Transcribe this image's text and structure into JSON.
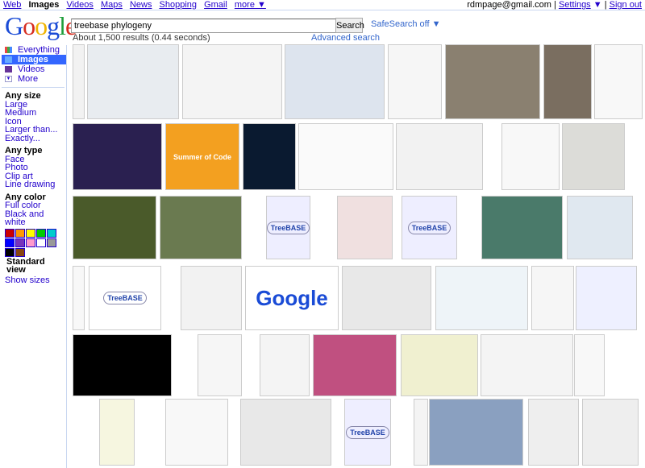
{
  "topbar": {
    "links": [
      "Web",
      "Images",
      "Videos",
      "Maps",
      "News",
      "Shopping",
      "Gmail",
      "more ▼"
    ],
    "user": "rdmpage@gmail.com",
    "settings": "Settings",
    "settings_arrow": "▼",
    "signout": "Sign out",
    "sep": "|"
  },
  "logo": "Google",
  "search": {
    "value": "treebase phylogeny",
    "button": "Search",
    "safesearch": "SafeSearch off ▼",
    "stats": "About 1,500 results (0.44 seconds)",
    "advanced": "Advanced search"
  },
  "sidebar": {
    "nav": [
      "Everything",
      "Images",
      "Videos",
      "More"
    ],
    "size": {
      "heading": "Any size",
      "items": [
        "Large",
        "Medium",
        "Icon",
        "Larger than...",
        "Exactly..."
      ]
    },
    "type": {
      "heading": "Any type",
      "items": [
        "Face",
        "Photo",
        "Clip art",
        "Line drawing"
      ]
    },
    "color": {
      "heading": "Any color",
      "items": [
        "Full color",
        "Black and white"
      ],
      "swatches": [
        "#cc0000",
        "#ff9900",
        "#ffff00",
        "#00cc00",
        "#00cccc",
        "#0000ff",
        "#7733bb",
        "#ff99cc",
        "#ffffff",
        "#999999",
        "#000000",
        "#884411"
      ]
    },
    "standard_view": "Standard view",
    "show_sizes": "Show sizes"
  },
  "tiles": [
    {
      "bg": "#f2f2f2"
    },
    {
      "bg": "#e8ecf0"
    },
    {
      "bg": "#f4f4f4"
    },
    {
      "bg": "#dde4ee"
    },
    {
      "bg": "#f6f6f6"
    },
    {
      "bg": "#8a8070"
    },
    {
      "bg": "#7a6e60"
    },
    {
      "bg": "#f8f8f8"
    },
    {
      "bg": "#2a2050"
    },
    {
      "bg": "#f3a020",
      "label": "Summer of Code"
    },
    {
      "bg": "#0a1a30"
    },
    {
      "bg": "#fafafa"
    },
    {
      "bg": "#f2f2f2"
    },
    {
      "bg": "#f8f8f8"
    },
    {
      "bg": "#dcdcd8"
    },
    {
      "bg": "#4a5a2a"
    },
    {
      "bg": "#6a7a50"
    },
    {
      "bg": "#eef",
      "label": "TreeBASE"
    },
    {
      "bg": "#f0e0e0"
    },
    {
      "bg": "#eef",
      "label": "TreeBASE"
    },
    {
      "bg": "#4a7a6a"
    },
    {
      "bg": "#e0e8f0"
    },
    {
      "bg": "#f8f8f8"
    },
    {
      "bg": "#fff",
      "label": "TreeBASE"
    },
    {
      "bg": "#f2f2f2"
    },
    {
      "bg": "#fff",
      "label": "Google"
    },
    {
      "bg": "#e8e8e8"
    },
    {
      "bg": "#eef4f8"
    },
    {
      "bg": "#f6f6f6"
    },
    {
      "bg": "#eef0ff"
    },
    {
      "bg": "#000"
    },
    {
      "bg": "#f6f6f6"
    },
    {
      "bg": "#f4f4f4"
    },
    {
      "bg": "#c05080"
    },
    {
      "bg": "#f0f0d0"
    },
    {
      "bg": "#f4f4f4"
    },
    {
      "bg": "#f8f8f8"
    },
    {
      "bg": "#f6f6e0"
    },
    {
      "bg": "#f8f8f8"
    },
    {
      "bg": "#e8e8e8"
    },
    {
      "bg": "#eef",
      "label": "TreeBASE"
    },
    {
      "bg": "#f4f4f4"
    },
    {
      "bg": "#8aa0c0"
    },
    {
      "bg": "#eeeeee"
    },
    {
      "bg": "#eeeeee"
    }
  ]
}
